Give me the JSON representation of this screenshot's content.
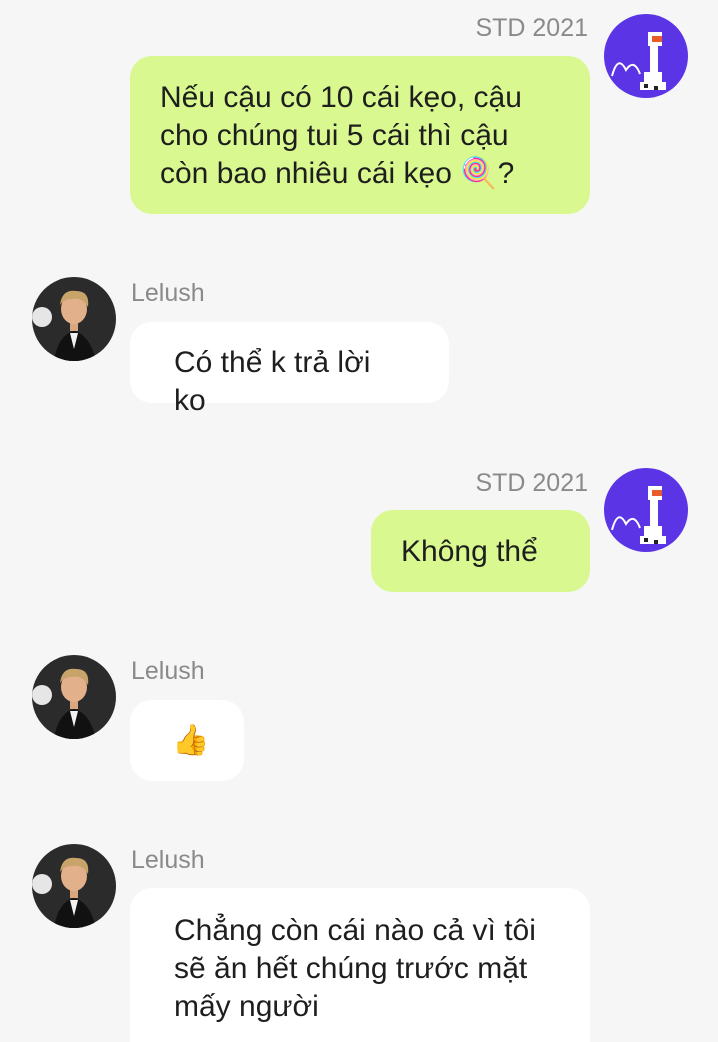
{
  "messages": [
    {
      "sender": "STD 2021",
      "side": "right",
      "text": "Nếu cậu có 10 cái kẹo, cậu cho chúng tui 5 cái thì cậu còn bao nhiêu cái kẹo",
      "emoji": "🍭",
      "suffix": "?"
    },
    {
      "sender": "Lelush",
      "side": "left",
      "text": "Có thể k trả lời ko"
    },
    {
      "sender": "STD 2021",
      "side": "right",
      "text": "Không thể"
    },
    {
      "sender": "Lelush",
      "side": "left",
      "text": "",
      "emoji": "👍"
    },
    {
      "sender": "Lelush",
      "side": "left",
      "text": "Chẳng còn cái nào cả vì tôi sẽ ăn hết chúng trước mặt mấy người"
    }
  ],
  "colors": {
    "background": "#f6f6f6",
    "my_bubble": "#d9f88f",
    "other_bubble": "#ffffff",
    "sender_name": "#8a8a8a",
    "std_avatar": "#5b34e6"
  },
  "avatars": {
    "std": "duck-avatar-icon",
    "lelush": "person-avatar-icon"
  }
}
